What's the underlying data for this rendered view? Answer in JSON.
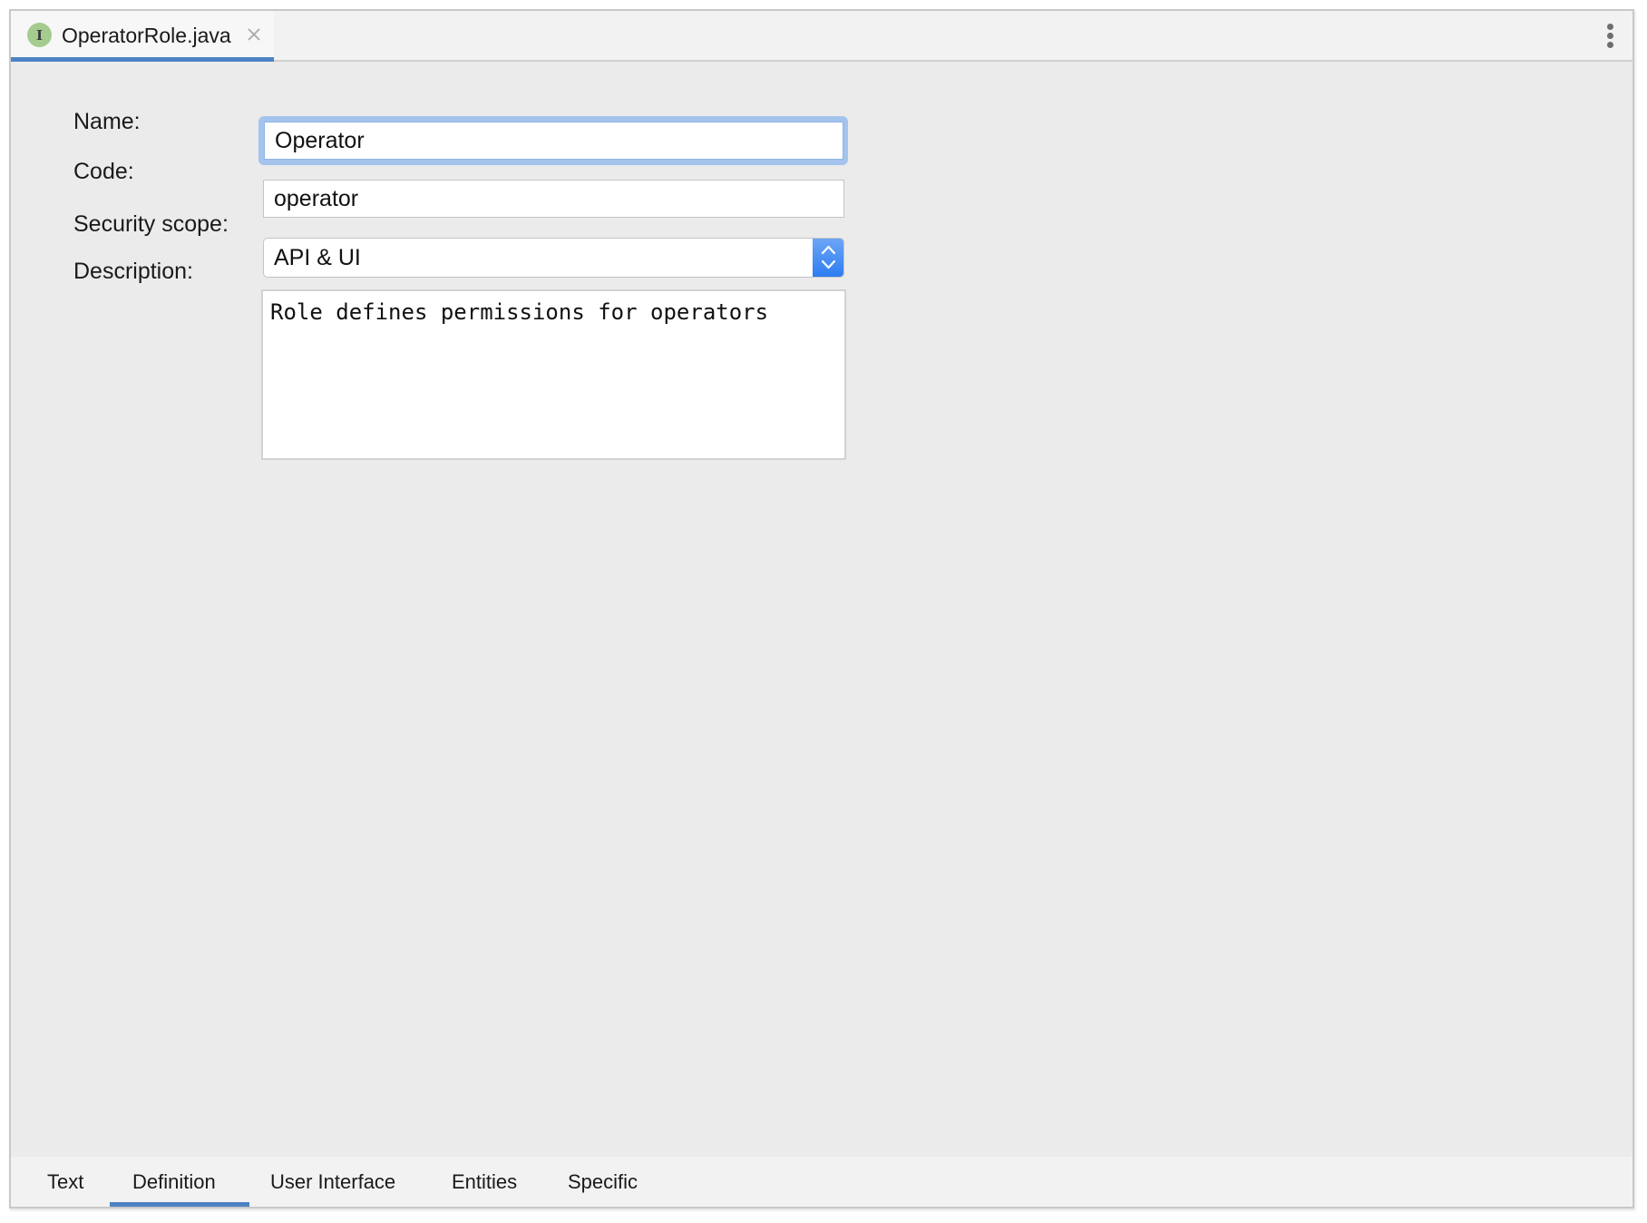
{
  "editor": {
    "file_tab": {
      "icon": "interface-icon",
      "icon_letter": "I",
      "name": "OperatorRole.java",
      "close_icon": "close-icon",
      "active": true
    },
    "menu_icon": "kebab-menu-icon"
  },
  "form": {
    "name": {
      "label": "Name:",
      "value": "Operator",
      "focused": true
    },
    "code": {
      "label": "Code:",
      "value": "operator"
    },
    "security_scope": {
      "label": "Security scope:",
      "value": "API & UI",
      "icon": "up-down-stepper-icon"
    },
    "description": {
      "label": "Description:",
      "value": "Role defines permissions for operators"
    }
  },
  "bottom_tabs": {
    "items": [
      {
        "label": "Text",
        "active": false
      },
      {
        "label": "Definition",
        "active": true
      },
      {
        "label": "User Interface",
        "active": false
      },
      {
        "label": "Entities",
        "active": false
      },
      {
        "label": "Specific",
        "active": false
      }
    ]
  },
  "colors": {
    "accent": "#4d82c5",
    "focus_ring": "#a4c4ee",
    "select_stepper_top": "#6ea7f6",
    "select_stepper_bottom": "#2c7cf0",
    "icon_green": "#a5cb8f",
    "background": "#ebebeb"
  }
}
